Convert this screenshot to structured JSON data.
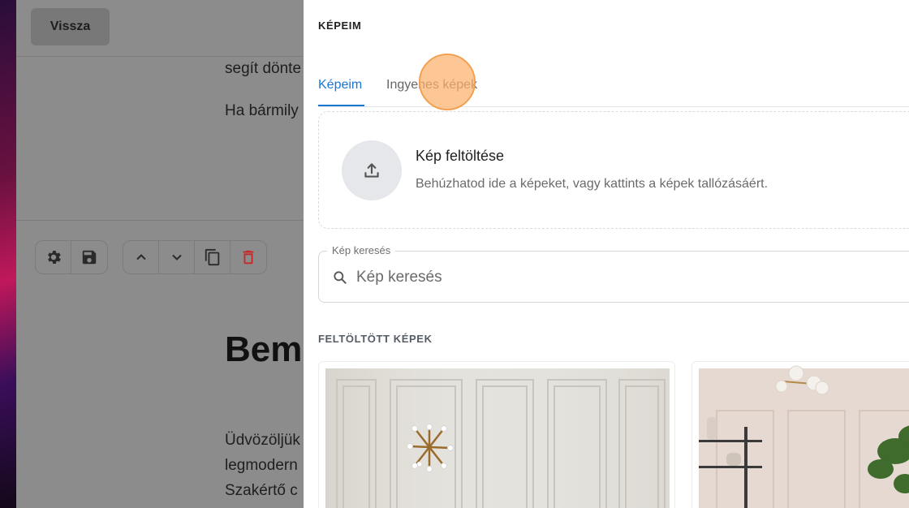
{
  "editor": {
    "back_label": "Vissza",
    "text_line_1": "segít dönte",
    "text_line_2": "Ha bármily",
    "heading": "Bemu",
    "paragraph_lines": [
      "Üdvözöljük",
      "legmodern",
      "Szakértő c"
    ],
    "toolbar_icons": [
      "gear-icon",
      "save-icon",
      "chevron-up-icon",
      "chevron-down-icon",
      "copy-icon",
      "delete-icon"
    ]
  },
  "dialog": {
    "title": "KÉPEIM",
    "tabs": [
      {
        "label": "Képeim",
        "active": true
      },
      {
        "label": "Ingyenes képek",
        "active": false
      }
    ],
    "upload": {
      "title": "Kép feltöltése",
      "description": "Behúzhatod ide a képeket, vagy kattints a képek tallózásáért."
    },
    "search": {
      "label": "Kép keresés",
      "placeholder": "Kép keresés"
    },
    "uploaded_section_label": "FELTÖLTÖTT KÉPEK"
  },
  "colors": {
    "accent": "#1976d2",
    "delete": "#c62828",
    "cursor": "#f8a95e"
  }
}
